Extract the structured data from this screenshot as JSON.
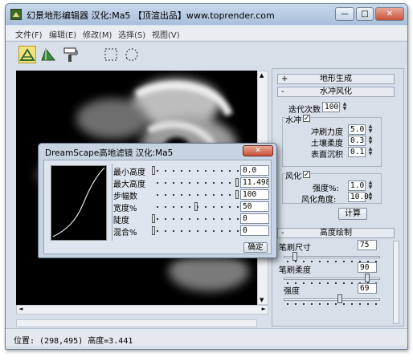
{
  "window": {
    "title": "幻景地形编辑器    汉化:Ma5 【顶渲出品】www.toprender.com",
    "min_glyph": "—",
    "max_glyph": "□",
    "close_glyph": "✕"
  },
  "menu": [
    "文件(F)",
    "编辑(E)",
    "修改(M)",
    "选择(S)",
    "视图(V)"
  ],
  "toolbar": {
    "tools": [
      "terrain-mountain-icon",
      "terrain-slope-icon",
      "paint-roller-icon",
      "select-rect-icon",
      "select-lasso-icon"
    ]
  },
  "scroll": {
    "up": "▲",
    "down": "▼",
    "left": "◄",
    "right": "►"
  },
  "status": {
    "text": "位置: (298,495) 高度=3.441"
  },
  "panel": {
    "rollout_terrain": {
      "symbol": "+",
      "title": "地形生成"
    },
    "rollout_erosion": {
      "symbol": "-",
      "title": "水冲风化"
    },
    "iterations": {
      "label": "迭代次数",
      "value": "100"
    },
    "water": {
      "title": "水冲",
      "checked": "✓",
      "fields": [
        {
          "label": "冲刷力度",
          "value": "5.0"
        },
        {
          "label": "土壤柔度",
          "value": "0.3"
        },
        {
          "label": "表面沉积",
          "value": "0.1"
        }
      ]
    },
    "wind": {
      "title": "风化",
      "checked": "✓",
      "fields": [
        {
          "label": "强度%:",
          "value": "1.0"
        },
        {
          "label": "风化角度:",
          "value": "10.0"
        }
      ]
    },
    "compute_button": "计算",
    "rollout_brush": {
      "symbol": "-",
      "title": "高度绘制"
    },
    "brush": [
      {
        "label": "笔刷尺寸",
        "value": "75",
        "level": 0.1
      },
      {
        "label": "笔刷柔度",
        "value": "90",
        "level": 0.9
      },
      {
        "label": "强度",
        "value": "69",
        "level": 0.6
      }
    ]
  },
  "dialog": {
    "title": "DreamScape高地滤镜    汉化:Ma5",
    "close_glyph": "✕",
    "rows": [
      {
        "label": "最小高度",
        "value": "0.0",
        "level": 0.0
      },
      {
        "label": "最大高度",
        "value": "11.498",
        "level": 0.98
      },
      {
        "label": "步幅数",
        "value": "100",
        "level": 0.98
      },
      {
        "label": "宽度%",
        "value": "50",
        "level": 0.5
      },
      {
        "label": "陡度",
        "value": "0",
        "level": 0.0
      },
      {
        "label": "混合%",
        "value": "0",
        "level": 0.0
      }
    ],
    "ok_button": "确定"
  }
}
